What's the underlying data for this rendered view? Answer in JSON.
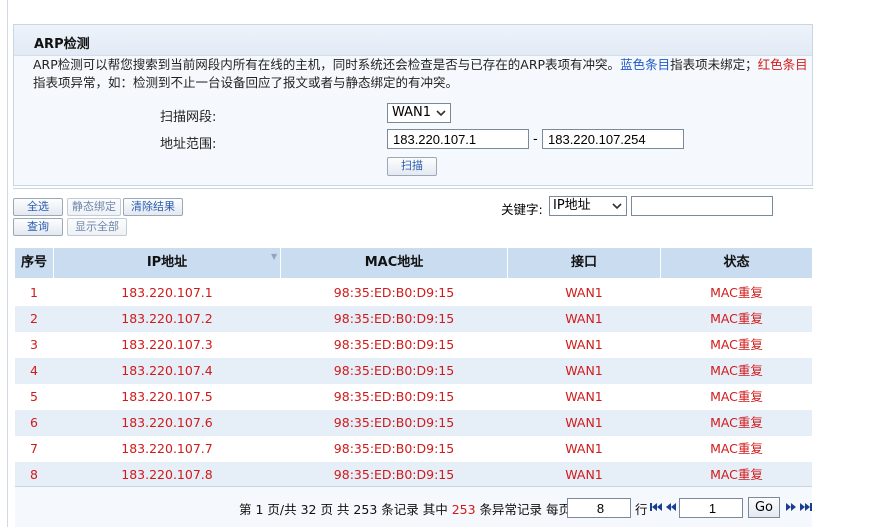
{
  "panel": {
    "title": "ARP检测",
    "desc": {
      "part1": "ARP检测可以帮您搜索到当前网段内所有在线的主机，同时系统还会检查是否与已存在的ARP表项有冲突。",
      "blue_label": "蓝色条目",
      "part2": "指表项未绑定；",
      "red_label": "红色条目",
      "part3": "指表项异常，如：检测到不止一台设备回应了报文或者与静态绑定的有冲突。"
    },
    "scan_segment_label": "扫描网段:",
    "scan_segment_value": "WAN1",
    "range_label": "地址范围:",
    "range_start": "183.220.107.1",
    "range_dash": "-",
    "range_end": "183.220.107.254",
    "scan_button": "扫描"
  },
  "toolbar": {
    "select_all": "全选",
    "static_bind": "静态绑定",
    "clear_results": "清除结果",
    "query": "查询",
    "show_all": "显示全部",
    "keyword_label": "关键字:",
    "keyword_select": "IP地址",
    "keyword_value": ""
  },
  "table": {
    "headers": [
      "序号",
      "IP地址",
      "MAC地址",
      "接口",
      "状态"
    ],
    "rows": [
      [
        "1",
        "183.220.107.1",
        "98:35:ED:B0:D9:15",
        "WAN1",
        "MAC重复"
      ],
      [
        "2",
        "183.220.107.2",
        "98:35:ED:B0:D9:15",
        "WAN1",
        "MAC重复"
      ],
      [
        "3",
        "183.220.107.3",
        "98:35:ED:B0:D9:15",
        "WAN1",
        "MAC重复"
      ],
      [
        "4",
        "183.220.107.4",
        "98:35:ED:B0:D9:15",
        "WAN1",
        "MAC重复"
      ],
      [
        "5",
        "183.220.107.5",
        "98:35:ED:B0:D9:15",
        "WAN1",
        "MAC重复"
      ],
      [
        "6",
        "183.220.107.6",
        "98:35:ED:B0:D9:15",
        "WAN1",
        "MAC重复"
      ],
      [
        "7",
        "183.220.107.7",
        "98:35:ED:B0:D9:15",
        "WAN1",
        "MAC重复"
      ],
      [
        "8",
        "183.220.107.8",
        "98:35:ED:B0:D9:15",
        "WAN1",
        "MAC重复"
      ]
    ]
  },
  "pager": {
    "summary_prefix": "第 1 页/共 32 页 共 253 条记录 其中 ",
    "abnormal_count": "253",
    "summary_suffix": " 条异常记录 每页",
    "per_page": "8",
    "rows_unit": "行",
    "current_page": "1",
    "go_label": "Go"
  },
  "colors": {
    "accent_blue": "#1b58c7",
    "alert_red": "#d11a1a",
    "header_bg": "#c9dcf0",
    "row_alt_bg": "#e6eef8"
  },
  "icons": [
    "chevron-down-icon",
    "sort-icon",
    "first-page-icon",
    "prev-page-icon",
    "next-page-icon",
    "last-page-icon"
  ]
}
